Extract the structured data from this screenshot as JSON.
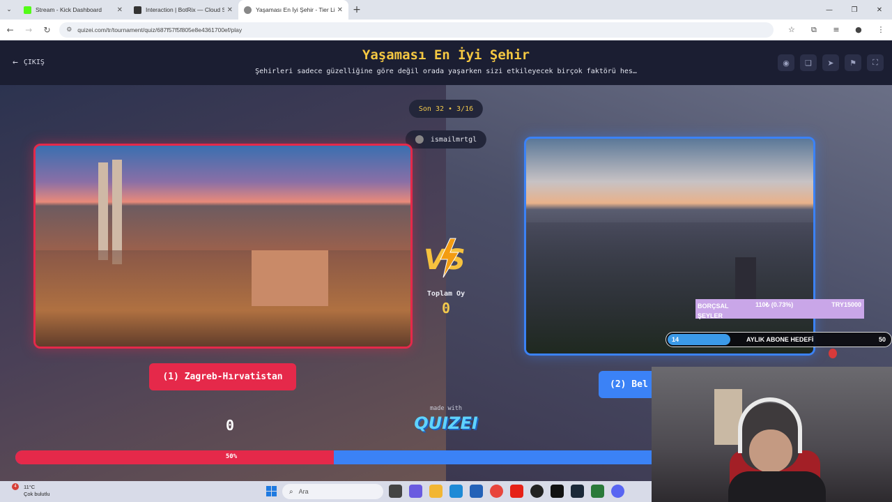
{
  "browser": {
    "tabs": [
      {
        "title": "Stream - Kick Dashboard",
        "color": "#53fc18"
      },
      {
        "title": "Interaction | BotRix — Cloud St",
        "color": "#333333"
      },
      {
        "title": "Yaşaması En İyi Şehir - Tier List",
        "color": "#2a2a2a"
      }
    ],
    "url": "quizei.com/tr/tournament/quiz/687f57f5f805e8e4361700ef/play"
  },
  "header": {
    "exit_label": "ÇIKIŞ",
    "title": "Yaşaması En İyi Şehir",
    "subtitle": "Şehirleri sadece güzelliğine göre değil orada yaşarken sizi etkileyecek birçok faktörü hes…"
  },
  "round": {
    "label": "Son 32 • 3/16",
    "username": "ismailmrtgl"
  },
  "vs": {
    "total_votes_label": "Toplam Oy",
    "total_votes": "0"
  },
  "left": {
    "choice_label": "(1) Zagreb-Hırvatistan",
    "score": "0",
    "accent": "#e5294a"
  },
  "right": {
    "choice_label": "(2) Bel",
    "accent": "#3b82f6"
  },
  "progress": {
    "percent_label": "50%",
    "left_fraction": 0.5
  },
  "footer": {
    "made_with": "made with",
    "brand": "QUIZEI"
  },
  "overlay": {
    "donation_name": "BORÇSAL ŞEYLER",
    "donation_amount": "110₺ (0.73%)",
    "donation_goal": "TRY15000",
    "subgoal_current": "14",
    "subgoal_label": "AYLIK ABONE HEDEFİ",
    "subgoal_target": "50",
    "subgoal_fraction": 0.28
  },
  "taskbar": {
    "temp": "11°C",
    "condition": "Çok bulutlu",
    "badge": "4",
    "search_placeholder": "Ara"
  }
}
